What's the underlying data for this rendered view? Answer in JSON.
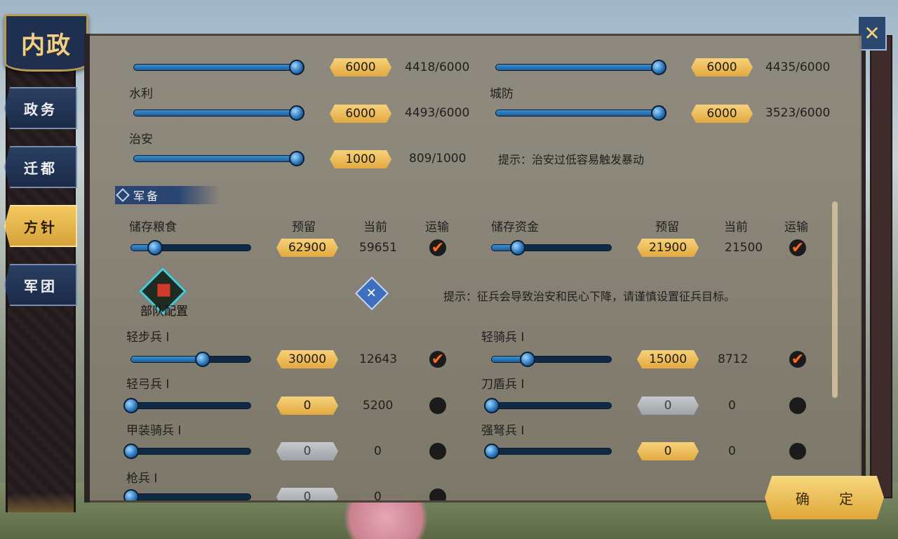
{
  "window": {
    "title": "内政",
    "close_icon": "close-icon"
  },
  "nav": [
    {
      "label": "政务",
      "active": false
    },
    {
      "label": "迁都",
      "active": false
    },
    {
      "label": "方针",
      "active": true
    },
    {
      "label": "军团",
      "active": false
    }
  ],
  "development": {
    "row1_left": {
      "value": "6000",
      "current": "4418/6000",
      "fill": 1.0
    },
    "row1_right": {
      "value": "6000",
      "current": "4435/6000",
      "fill": 1.0
    },
    "water": {
      "label": "水利",
      "value": "6000",
      "current": "4493/6000",
      "fill": 1.0
    },
    "defense": {
      "label": "城防",
      "value": "6000",
      "current": "3523/6000",
      "fill": 1.0
    },
    "order": {
      "label": "治安",
      "value": "1000",
      "current": "809/1000",
      "fill": 1.0
    },
    "order_hint": "提示：治安过低容易触发暴动"
  },
  "military": {
    "section_label": "军备",
    "headers": {
      "reserve": "预留",
      "current": "当前",
      "transport": "运输"
    },
    "food": {
      "label": "储存粮食",
      "value": "62900",
      "current": "59651",
      "transport": true,
      "fill": 0.2
    },
    "funds": {
      "label": "储存资金",
      "value": "21900",
      "current": "21500",
      "transport": true,
      "fill": 0.22
    },
    "troop_config_label": "部队配置",
    "recruit_hint": "提示：征兵会导致治安和民心下降，请谨慎设置征兵目标。",
    "troops": [
      {
        "label": "轻步兵 I",
        "value": "30000",
        "current": "12643",
        "transport": true,
        "enabled": true,
        "fill": 0.6
      },
      {
        "label": "轻骑兵 I",
        "value": "15000",
        "current": "8712",
        "transport": true,
        "enabled": true,
        "fill": 0.3
      },
      {
        "label": "轻弓兵 I",
        "value": "0",
        "current": "5200",
        "transport": false,
        "enabled": true,
        "fill": 0.0
      },
      {
        "label": "刀盾兵 I",
        "value": "0",
        "current": "0",
        "transport": false,
        "enabled": false,
        "fill": 0.0
      },
      {
        "label": "甲装骑兵 I",
        "value": "0",
        "current": "0",
        "transport": false,
        "enabled": false,
        "fill": 0.0
      },
      {
        "label": "强弩兵 I",
        "value": "0",
        "current": "0",
        "transport": false,
        "enabled": true,
        "fill": 0.0
      },
      {
        "label": "枪兵 I",
        "value": "0",
        "current": "0",
        "transport": false,
        "enabled": false,
        "fill": 0.0
      }
    ]
  },
  "confirm_label": "确 定",
  "colors": {
    "accent_gold": "#e2a940",
    "nav_blue": "#1b2b47",
    "checkmark": "#ff6a1a"
  }
}
